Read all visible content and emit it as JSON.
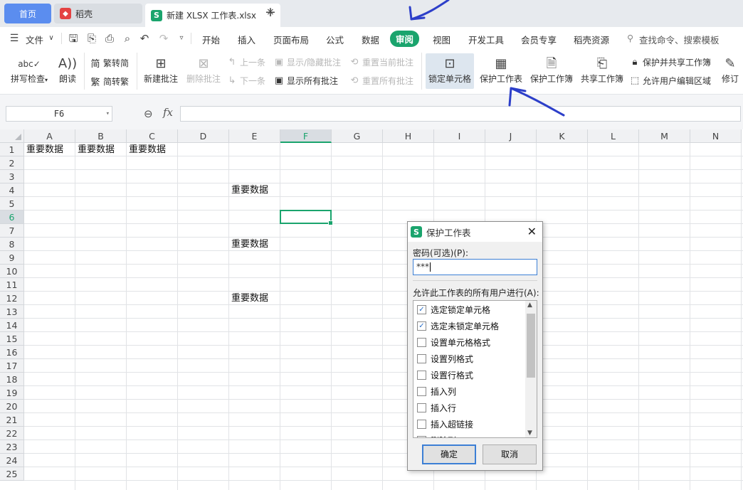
{
  "tabs": {
    "home": "首页",
    "daoke": "稻壳",
    "file": "新建 XLSX 工作表.xlsx",
    "close": "×",
    "add": "+"
  },
  "menu": {
    "file": "文件",
    "items": [
      "开始",
      "插入",
      "页面布局",
      "公式",
      "数据",
      "审阅",
      "视图",
      "开发工具",
      "会员专享",
      "稻壳资源"
    ],
    "active": "审阅",
    "search": "查找命令、搜索模板"
  },
  "ribbon": {
    "spellcheck": "拼写检查",
    "read": "朗读",
    "trad_to_simp": "繁转简",
    "simp_to_trad": "简转繁",
    "new_comment": "新建批注",
    "delete_comment": "删除批注",
    "prev": "上一条",
    "next": "下一条",
    "show_hide_comment": "显示/隐藏批注",
    "show_all_comments": "显示所有批注",
    "reset_current_comment": "重置当前批注",
    "reset_all_comments": "重置所有批注",
    "lock_cells": "锁定单元格",
    "protect_sheet": "保护工作表",
    "protect_workbook": "保护工作簿",
    "share_workbook": "共享工作簿",
    "protect_and_share": "保护并共享工作簿",
    "allow_edit_ranges": "允许用户编辑区域",
    "track_changes": "修订"
  },
  "formula_bar": {
    "name_box": "F6",
    "fx": "fx",
    "formula": ""
  },
  "grid": {
    "columns": [
      "A",
      "B",
      "C",
      "D",
      "E",
      "F",
      "G",
      "H",
      "I",
      "J",
      "K",
      "L",
      "M",
      "N"
    ],
    "rows": [
      "1",
      "2",
      "3",
      "4",
      "5",
      "6",
      "7",
      "8",
      "9",
      "10",
      "11",
      "12",
      "13",
      "14",
      "15",
      "16",
      "17",
      "18",
      "19",
      "20",
      "21",
      "22",
      "23",
      "24",
      "25"
    ],
    "selected_cell": "F6",
    "cells": {
      "A1": "重要数据",
      "B1": "重要数据",
      "C1": "重要数据",
      "E4": "重要数据",
      "E8": "重要数据",
      "E12": "重要数据"
    }
  },
  "dialog": {
    "title": "保护工作表",
    "password_label": "密码(可选)(P):",
    "password_value": "***",
    "allow_label": "允许此工作表的所有用户进行(A):",
    "permissions": [
      {
        "label": "选定锁定单元格",
        "checked": true
      },
      {
        "label": "选定未锁定单元格",
        "checked": true
      },
      {
        "label": "设置单元格格式",
        "checked": false
      },
      {
        "label": "设置列格式",
        "checked": false
      },
      {
        "label": "设置行格式",
        "checked": false
      },
      {
        "label": "插入列",
        "checked": false
      },
      {
        "label": "插入行",
        "checked": false
      },
      {
        "label": "插入超链接",
        "checked": false
      },
      {
        "label": "删除列",
        "checked": false
      }
    ],
    "ok": "确定",
    "cancel": "取消"
  },
  "colors": {
    "accent": "#1aa46d",
    "home_tab": "#5b8def",
    "annotation": "#2d3fc9"
  }
}
